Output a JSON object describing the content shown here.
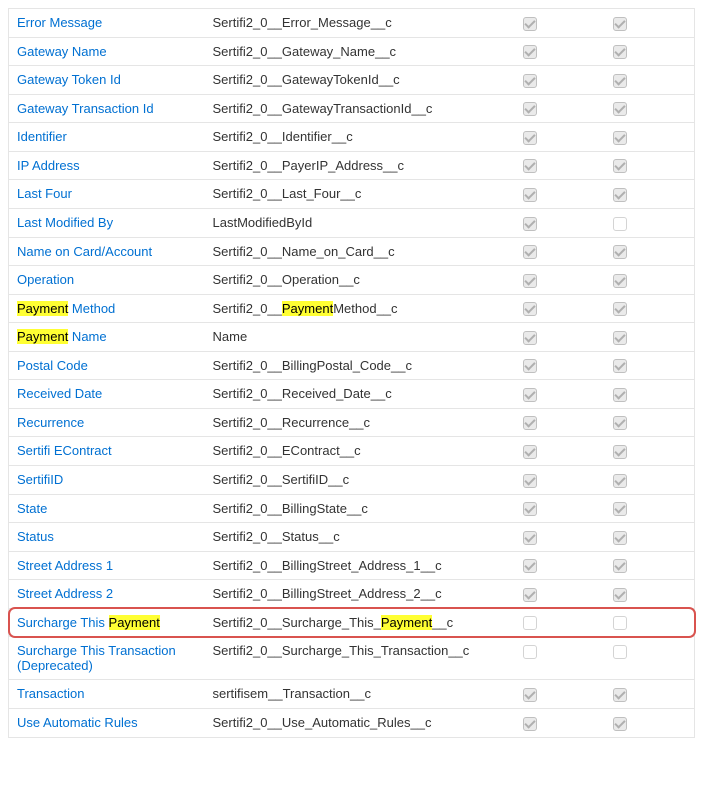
{
  "highlight_term": "Payment",
  "rows": [
    {
      "label": "Error Message",
      "api": "Sertifi2_0__Error_Message__c",
      "c1": "checked-disabled",
      "c2": "checked-disabled"
    },
    {
      "label": "Gateway Name",
      "api": "Sertifi2_0__Gateway_Name__c",
      "c1": "checked-disabled",
      "c2": "checked-disabled"
    },
    {
      "label": "Gateway Token Id",
      "api": "Sertifi2_0__GatewayTokenId__c",
      "c1": "checked-disabled",
      "c2": "checked-disabled"
    },
    {
      "label": "Gateway Transaction Id",
      "api": "Sertifi2_0__GatewayTransactionId__c",
      "c1": "checked-disabled",
      "c2": "checked-disabled"
    },
    {
      "label": "Identifier",
      "api": "Sertifi2_0__Identifier__c",
      "c1": "checked-disabled",
      "c2": "checked-disabled"
    },
    {
      "label": "IP Address",
      "api": "Sertifi2_0__PayerIP_Address__c",
      "c1": "checked-disabled",
      "c2": "checked-disabled"
    },
    {
      "label": "Last Four",
      "api": "Sertifi2_0__Last_Four__c",
      "c1": "checked-disabled",
      "c2": "checked-disabled"
    },
    {
      "label": "Last Modified By",
      "api": "LastModifiedById",
      "c1": "checked-disabled",
      "c2": "unchecked"
    },
    {
      "label": "Name on Card/Account",
      "api": "Sertifi2_0__Name_on_Card__c",
      "c1": "checked-disabled",
      "c2": "checked-disabled"
    },
    {
      "label": "Operation",
      "api": "Sertifi2_0__Operation__c",
      "c1": "checked-disabled",
      "c2": "checked-disabled"
    },
    {
      "label": "Payment Method",
      "api": "Sertifi2_0__PaymentMethod__c",
      "c1": "checked-disabled",
      "c2": "checked-disabled"
    },
    {
      "label": "Payment Name",
      "api": "Name",
      "c1": "checked-disabled",
      "c2": "checked-disabled"
    },
    {
      "label": "Postal Code",
      "api": "Sertifi2_0__BillingPostal_Code__c",
      "c1": "checked-disabled",
      "c2": "checked-disabled"
    },
    {
      "label": "Received Date",
      "api": "Sertifi2_0__Received_Date__c",
      "c1": "checked-disabled",
      "c2": "checked-disabled"
    },
    {
      "label": "Recurrence",
      "api": "Sertifi2_0__Recurrence__c",
      "c1": "checked-disabled",
      "c2": "checked-disabled"
    },
    {
      "label": "Sertifi EContract",
      "api": "Sertifi2_0__EContract__c",
      "c1": "checked-disabled",
      "c2": "checked-disabled"
    },
    {
      "label": "SertifiID",
      "api": "Sertifi2_0__SertifiID__c",
      "c1": "checked-disabled",
      "c2": "checked-disabled"
    },
    {
      "label": "State",
      "api": "Sertifi2_0__BillingState__c",
      "c1": "checked-disabled",
      "c2": "checked-disabled"
    },
    {
      "label": "Status",
      "api": "Sertifi2_0__Status__c",
      "c1": "checked-disabled",
      "c2": "checked-disabled"
    },
    {
      "label": "Street Address 1",
      "api": "Sertifi2_0__BillingStreet_Address_1__c",
      "c1": "checked-disabled",
      "c2": "checked-disabled"
    },
    {
      "label": "Street Address 2",
      "api": "Sertifi2_0__BillingStreet_Address_2__c",
      "c1": "checked-disabled",
      "c2": "checked-disabled"
    },
    {
      "label": "Surcharge This Payment",
      "api": "Sertifi2_0__Surcharge_This_Payment__c",
      "c1": "unchecked",
      "c2": "unchecked",
      "highlight_row": true
    },
    {
      "label": "Surcharge This Transaction (Deprecated)",
      "api": "Sertifi2_0__Surcharge_This_Transaction__c",
      "c1": "unchecked",
      "c2": "unchecked"
    },
    {
      "label": "Transaction",
      "api": "sertifisem__Transaction__c",
      "c1": "checked-disabled",
      "c2": "checked-disabled"
    },
    {
      "label": "Use Automatic Rules",
      "api": "Sertifi2_0__Use_Automatic_Rules__c",
      "c1": "checked-disabled",
      "c2": "checked-disabled"
    }
  ]
}
